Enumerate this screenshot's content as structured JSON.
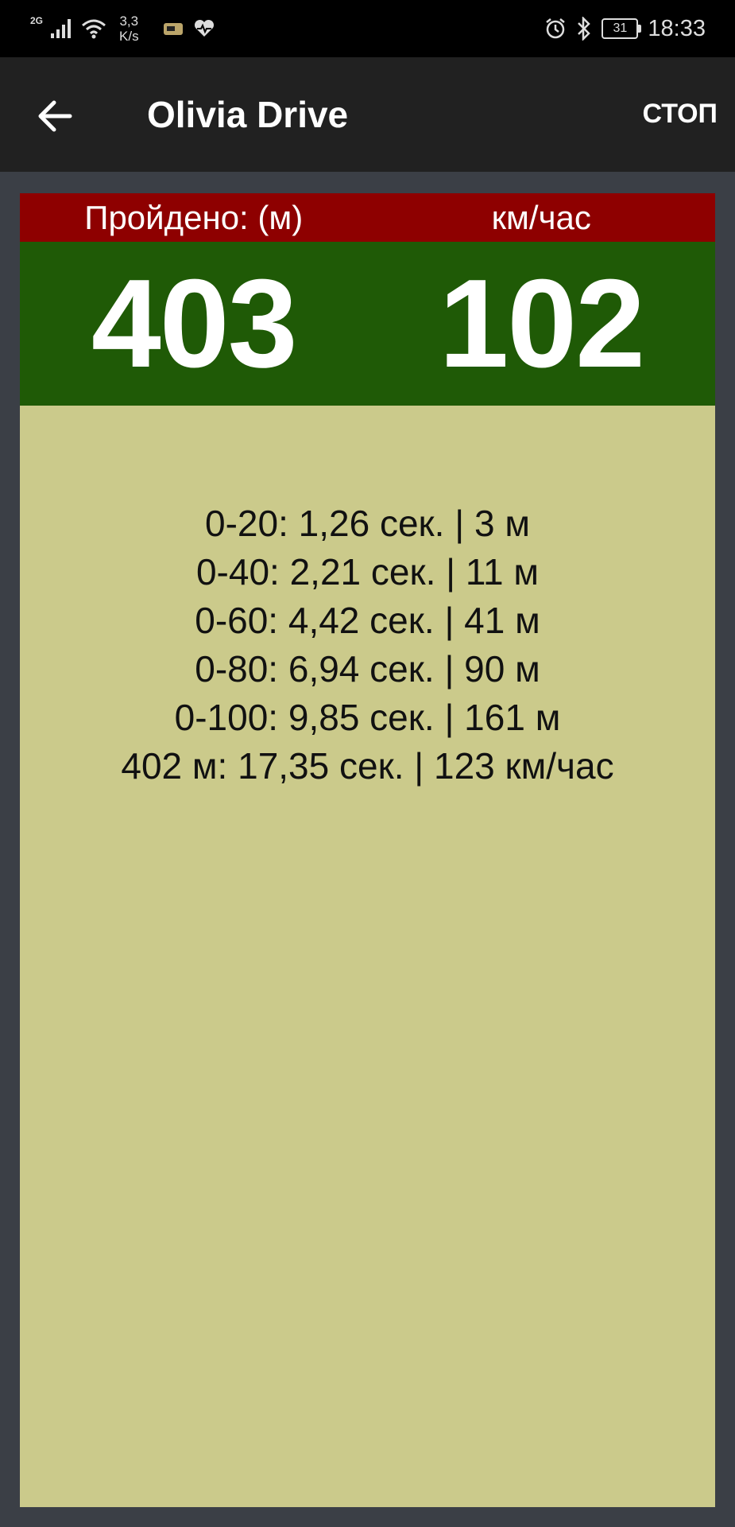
{
  "status_bar": {
    "network": "2G",
    "speed": "3,3",
    "speed_unit": "K/s",
    "battery": "31",
    "time": "18:33"
  },
  "app_bar": {
    "title": "Olivia Drive",
    "stop_label": "СТОП"
  },
  "metrics": {
    "distance_label": "Пройдено: (м)",
    "speed_label": "км/час",
    "distance_value": "403",
    "speed_value": "102"
  },
  "results": [
    "0-20: 1,26 сек. | 3 м",
    "0-40: 2,21 сек. | 11 м",
    "0-60: 4,42 сек. | 41 м",
    "0-80: 6,94 сек. | 90 м",
    "0-100: 9,85 сек. | 161 м",
    "402 м: 17,35 сек. | 123 км/час"
  ],
  "colors": {
    "label_bg": "#8e0000",
    "value_bg": "#1f5a06",
    "results_bg": "#cbca8b",
    "appbar_bg": "#212121"
  }
}
